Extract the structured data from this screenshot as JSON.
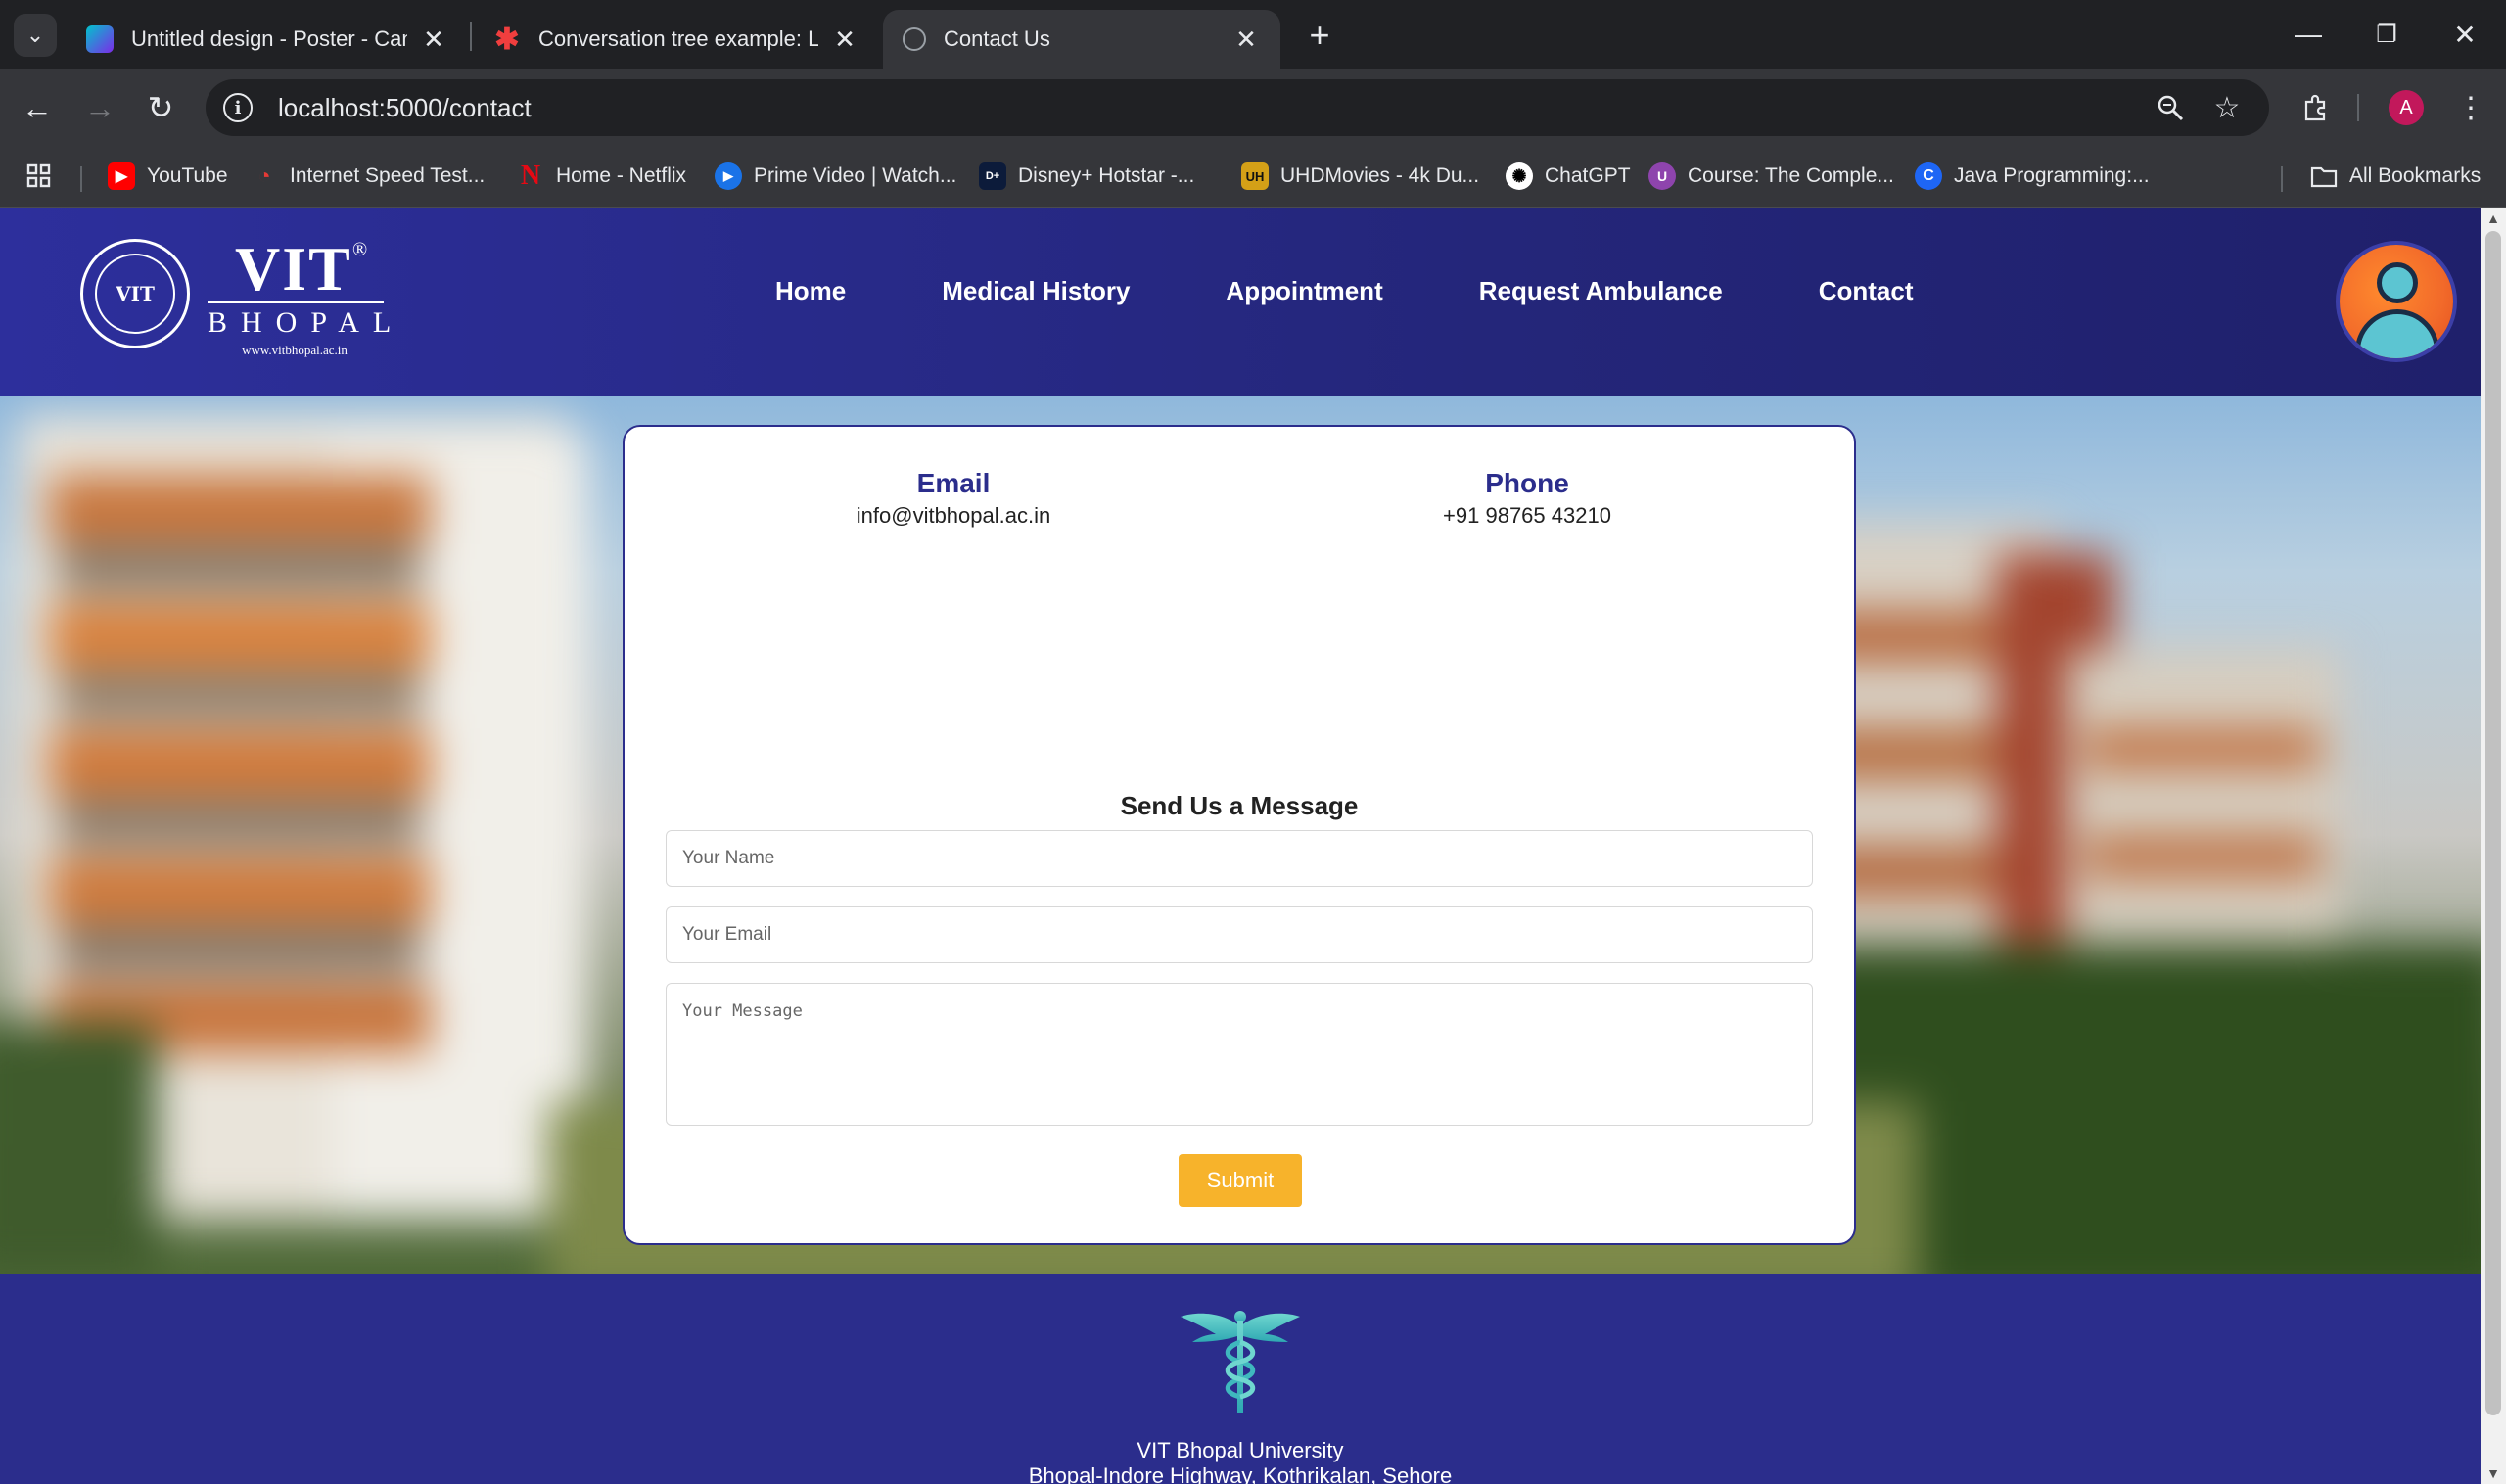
{
  "browser": {
    "tabs": [
      {
        "title": "Untitled design - Poster - Canva",
        "active": false,
        "icon": "canva-icon"
      },
      {
        "title": "Conversation tree example: Lucid",
        "active": false,
        "icon": "lucid-icon"
      },
      {
        "title": "Contact Us",
        "active": true,
        "icon": "globe-icon"
      }
    ],
    "url": "localhost:5000/contact",
    "profile_letter": "A",
    "bookmarks": [
      {
        "label": "YouTube",
        "icon": "youtube-icon",
        "color": "#ff0000"
      },
      {
        "label": "Internet Speed Test...",
        "icon": "speedtest-icon",
        "color": "#e53935"
      },
      {
        "label": "Home - Netflix",
        "icon": "netflix-icon",
        "color": "#e50914"
      },
      {
        "label": "Prime Video | Watch...",
        "icon": "prime-video-icon",
        "color": "#1a73e8"
      },
      {
        "label": "Disney+ Hotstar -...",
        "icon": "hotstar-icon",
        "color": "#0c1b3a"
      },
      {
        "label": "UHDMovies - 4k Du...",
        "icon": "uhdmovies-icon",
        "color": "#d4a017"
      },
      {
        "label": "ChatGPT",
        "icon": "chatgpt-icon",
        "color": "#000000"
      },
      {
        "label": "Course: The Comple...",
        "icon": "course-icon",
        "color": "#8e44ad"
      },
      {
        "label": "Java Programming:...",
        "icon": "java-icon",
        "color": "#1e66f5"
      }
    ],
    "all_bookmarks": "All Bookmarks"
  },
  "site": {
    "logo": {
      "name": "VIT",
      "reg": "®",
      "sub": "BHOPAL",
      "website": "www.vitbhopal.ac.in",
      "seal_text": "VIT"
    },
    "nav": [
      "Home",
      "Medical History",
      "Appointment",
      "Request Ambulance",
      "Contact"
    ],
    "colors": {
      "primary": "#2b2d8c",
      "accent": "#f7b32b"
    }
  },
  "contact": {
    "email_label": "Email",
    "email_value": "info@vitbhopal.ac.in",
    "phone_label": "Phone",
    "phone_value": "+91 98765 43210",
    "form_title": "Send Us a Message",
    "name_placeholder": "Your Name",
    "email_placeholder": "Your Email",
    "message_placeholder": "Your Message",
    "submit_label": "Submit"
  },
  "footer": {
    "line1": "VIT Bhopal University",
    "line2": "Bhopal-Indore Highway, Kothrikalan, Sehore"
  }
}
